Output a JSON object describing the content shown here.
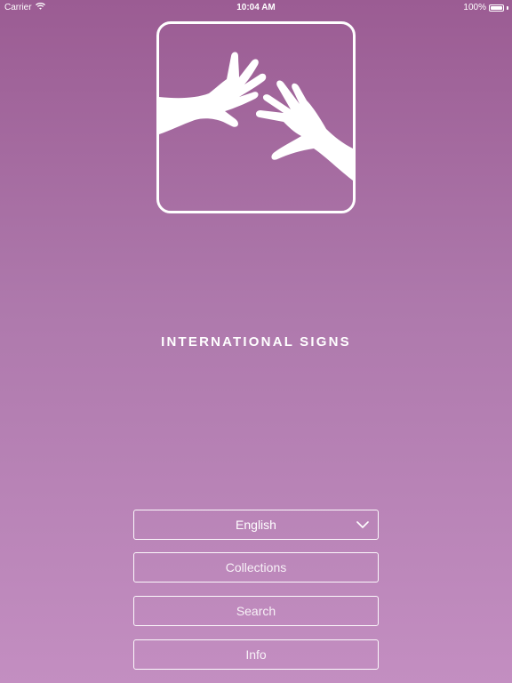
{
  "status_bar": {
    "carrier": "Carrier",
    "time": "10:04 AM",
    "battery": "100%",
    "battery_level": 1.0
  },
  "app": {
    "title": "INTERNATIONAL SIGNS",
    "logo_icon": "signing-hands-icon"
  },
  "menu": {
    "language": "English",
    "collections_label": "Collections",
    "search_label": "Search",
    "info_label": "Info"
  },
  "colors": {
    "background_top": "#9b5c93",
    "background_bottom": "#c38ec1",
    "foreground": "#ffffff"
  }
}
